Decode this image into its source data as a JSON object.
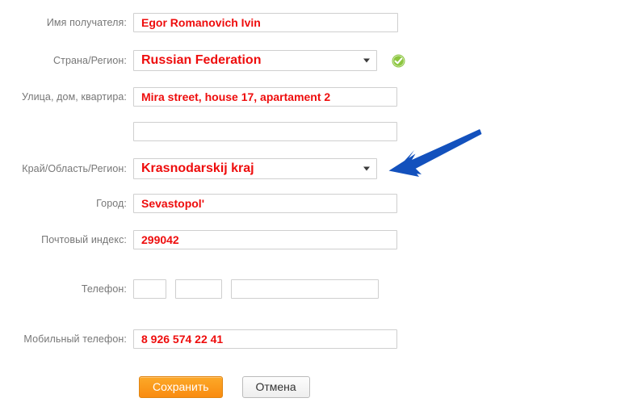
{
  "form": {
    "fields": [
      {
        "id": "recipient-name",
        "label": "Имя получателя:",
        "type": "text",
        "value": "Egor Romanovich Ivin"
      },
      {
        "id": "country-region",
        "label": "Страна/Регион:",
        "type": "select",
        "value": "Russian Federation",
        "caret": "▼",
        "validated": true,
        "valid_icon": "check-circle-icon"
      },
      {
        "id": "street-address",
        "label": "Улица, дом, квартира:",
        "type": "text",
        "value": "Mira street, house 17, apartament 2"
      },
      {
        "id": "address-line-2",
        "label": "",
        "type": "text",
        "value": ""
      },
      {
        "id": "state-province-region",
        "label": "Край/Область/Регион:",
        "type": "select",
        "value": "Krasnodarskij kraj",
        "caret": "▼"
      },
      {
        "id": "city",
        "label": "Город:",
        "type": "text",
        "value": "Sevastopol'"
      },
      {
        "id": "postal-code",
        "label": "Почтовый индекс:",
        "type": "text",
        "value": "299042"
      }
    ],
    "phone": {
      "label": "Телефон:",
      "part_country": "",
      "part_area": "",
      "part_number": ""
    },
    "mobile": {
      "label": "Мобильный телефон:",
      "value": "8 926 574 22 41"
    },
    "buttons": {
      "save_label": "Сохранить",
      "cancel_label": "Отмена"
    }
  },
  "annotation": {
    "arrow": "arrow-pointing-left",
    "color": "#1351bd"
  },
  "colors": {
    "value_text": "#ee0d0d",
    "label_text": "#777777",
    "input_border": "#cfcfcf",
    "save_button": "#f98b10",
    "valid_green": "#8cc63f",
    "annotation_blue": "#1351bd"
  }
}
